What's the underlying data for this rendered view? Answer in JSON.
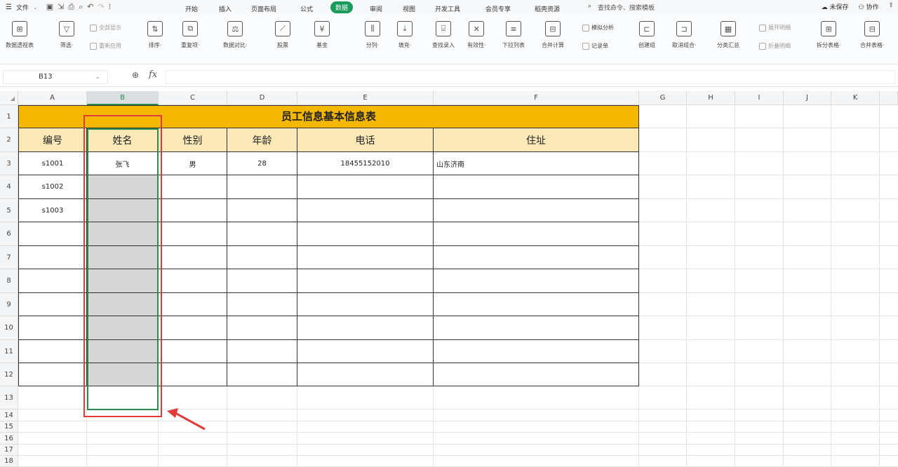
{
  "menu": {
    "file": "文件",
    "tabs": [
      "开始",
      "插入",
      "页面布局",
      "公式",
      "数据",
      "审阅",
      "视图",
      "开发工具",
      "会员专享",
      "稻壳资源"
    ],
    "active_tab": "数据",
    "search": "查找命令、搜索模板",
    "right": [
      "未保存",
      "协作"
    ]
  },
  "ribbon": {
    "buttons": [
      {
        "label": "数据透视表",
        "icon": "pivot-icon"
      },
      {
        "label": "筛选·",
        "icon": "filter-icon"
      },
      {
        "label": "排序·",
        "icon": "sort-icon"
      },
      {
        "label": "重复项·",
        "icon": "duplicate-icon"
      },
      {
        "label": "数据对比·",
        "icon": "compare-icon"
      },
      {
        "label": "股票",
        "icon": "stock-icon"
      },
      {
        "label": "基金",
        "icon": "fund-icon"
      },
      {
        "label": "分列·",
        "icon": "split-column-icon"
      },
      {
        "label": "填充·",
        "icon": "fill-icon"
      },
      {
        "label": "查找录入",
        "icon": "lookup-entry-icon"
      },
      {
        "label": "有效性·",
        "icon": "validation-icon"
      },
      {
        "label": "下拉列表",
        "icon": "dropdown-list-icon"
      },
      {
        "label": "合并计算",
        "icon": "consolidate-icon"
      },
      {
        "label": "创建组",
        "icon": "group-icon"
      },
      {
        "label": "取消组合·",
        "icon": "ungroup-icon"
      },
      {
        "label": "分类汇总",
        "icon": "subtotal-icon"
      },
      {
        "label": "拆分表格·",
        "icon": "split-table-icon"
      },
      {
        "label": "合并表格·",
        "icon": "merge-table-icon"
      }
    ],
    "small": {
      "show_all": "全部显示",
      "reapply": "重新应用",
      "whatif": "模拟分析",
      "record": "记录单",
      "expand": "展开明细",
      "collapse": "折叠明细"
    }
  },
  "formula_bar": {
    "cell_ref": "B13",
    "fx": "fx",
    "content": ""
  },
  "columns": [
    "A",
    "B",
    "C",
    "D",
    "E",
    "F",
    "G",
    "H",
    "I",
    "J",
    "K"
  ],
  "selected_column": "B",
  "rows": [
    "1",
    "2",
    "3",
    "4",
    "5",
    "6",
    "7",
    "8",
    "9",
    "10",
    "11",
    "12",
    "13",
    "14",
    "15",
    "16",
    "17",
    "18"
  ],
  "sheet": {
    "title": "员工信息基本信息表",
    "headers": [
      "编号",
      "姓名",
      "性别",
      "年龄",
      "电话",
      "住址"
    ],
    "data": [
      [
        "s1001",
        "张飞",
        "男",
        "28",
        "18455152010",
        "山东济南"
      ],
      [
        "s1002",
        "",
        "",
        "",
        "",
        ""
      ],
      [
        "s1003",
        "",
        "",
        "",
        "",
        ""
      ],
      [
        "",
        "",
        "",
        "",
        "",
        ""
      ],
      [
        "",
        "",
        "",
        "",
        "",
        ""
      ],
      [
        "",
        "",
        "",
        "",
        "",
        ""
      ],
      [
        "",
        "",
        "",
        "",
        "",
        ""
      ],
      [
        "",
        "",
        "",
        "",
        "",
        ""
      ],
      [
        "",
        "",
        "",
        "",
        "",
        ""
      ],
      [
        "",
        "",
        "",
        "",
        "",
        ""
      ]
    ]
  },
  "colors": {
    "title_fill": "#f5b800",
    "header_fill": "#fde9b8",
    "selection_fill": "#d7d7d7",
    "selection_border": "#2a8a4e",
    "annotation_red": "#e03a3a",
    "active_tab": "#1a9b5c"
  }
}
